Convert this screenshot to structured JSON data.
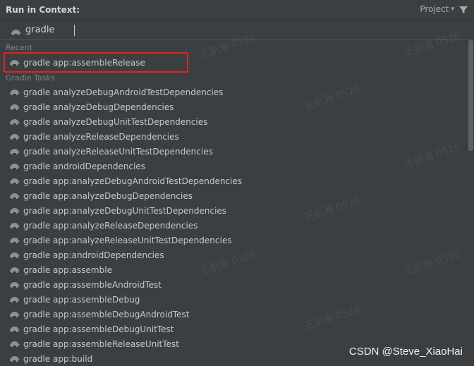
{
  "header": {
    "title": "Run in Context:",
    "scope_label": "Project",
    "scope_chevron": "▾",
    "filter_icon": "filter-icon"
  },
  "search": {
    "value": "gradle",
    "icon": "gradle-icon"
  },
  "groups": {
    "recent": "Recent",
    "gradle_tasks": "Gradle Tasks"
  },
  "recent_items": [
    {
      "label": "gradle app:assembleRelease"
    }
  ],
  "task_items": [
    {
      "label": "gradle analyzeDebugAndroidTestDependencies"
    },
    {
      "label": "gradle analyzeDebugDependencies"
    },
    {
      "label": "gradle analyzeDebugUnitTestDependencies"
    },
    {
      "label": "gradle analyzeReleaseDependencies"
    },
    {
      "label": "gradle analyzeReleaseUnitTestDependencies"
    },
    {
      "label": "gradle androidDependencies"
    },
    {
      "label": "gradle app:analyzeDebugAndroidTestDependencies"
    },
    {
      "label": "gradle app:analyzeDebugDependencies"
    },
    {
      "label": "gradle app:analyzeDebugUnitTestDependencies"
    },
    {
      "label": "gradle app:analyzeReleaseDependencies"
    },
    {
      "label": "gradle app:analyzeReleaseUnitTestDependencies"
    },
    {
      "label": "gradle app:androidDependencies"
    },
    {
      "label": "gradle app:assemble"
    },
    {
      "label": "gradle app:assembleAndroidTest"
    },
    {
      "label": "gradle app:assembleDebug"
    },
    {
      "label": "gradle app:assembleDebugAndroidTest"
    },
    {
      "label": "gradle app:assembleDebugUnitTest"
    },
    {
      "label": "gradle app:assembleReleaseUnitTest"
    },
    {
      "label": "gradle app:build"
    }
  ],
  "watermark_text": "王航海 0520",
  "credit": "CSDN @Steve_XiaoHai",
  "colors": {
    "background": "#3c3f41",
    "highlight_box": "#e0241f",
    "text": "#c8c8c8",
    "group_label": "#808080"
  }
}
